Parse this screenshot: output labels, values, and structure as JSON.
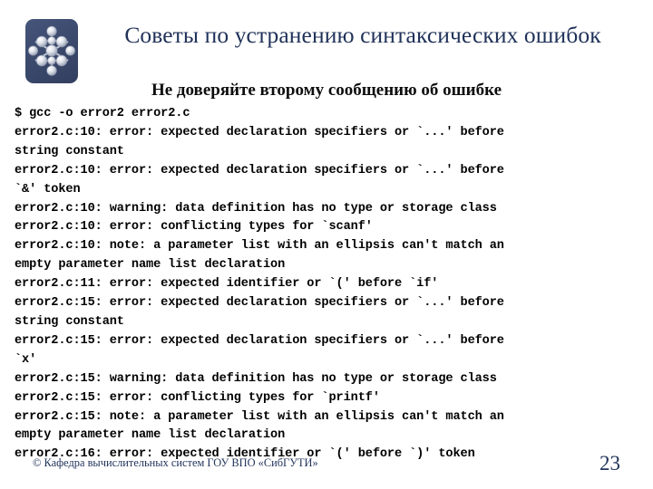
{
  "slide": {
    "title": "Советы по устранению синтаксических ошибок",
    "subtitle": "Не доверяйте второму сообщению об ошибке",
    "page_number": "23",
    "footer": "© Кафедра вычислительных систем ГОУ ВПО «СибГУТИ»"
  },
  "colors": {
    "title": "#1F3158",
    "subtitle": "#0D0D0D",
    "footer": "#22355C",
    "logo_background": "#3B4A6D",
    "logo_spheres": "#DCE0E8",
    "code_text": "#000000",
    "page_background": "#FFFFFF"
  },
  "logo": {
    "name": "sibguti-molecule-logo",
    "shape": "rounded-rect-with-molecular-snowflake"
  },
  "console": {
    "lines": [
      "$ gcc -o error2 error2.c",
      "error2.c:10: error: expected declaration specifiers or `...' before",
      "string constant",
      "error2.c:10: error: expected declaration specifiers or `...' before",
      "`&' token",
      "error2.c:10: warning: data definition has no type or storage class",
      "error2.c:10: error: conflicting types for `scanf'",
      "error2.c:10: note: a parameter list with an ellipsis can't match an",
      "empty parameter name list declaration",
      "error2.c:11: error: expected identifier or `(' before `if'",
      "error2.c:15: error: expected declaration specifiers or `...' before",
      "string constant",
      "error2.c:15: error: expected declaration specifiers or `...' before",
      "`x'",
      "error2.c:15: warning: data definition has no type or storage class",
      "error2.c:15: error: conflicting types for `printf'",
      "error2.c:15: note: a parameter list with an ellipsis can't match an",
      "empty parameter name list declaration",
      "error2.c:16: error: expected identifier or `(' before `)' token"
    ]
  }
}
